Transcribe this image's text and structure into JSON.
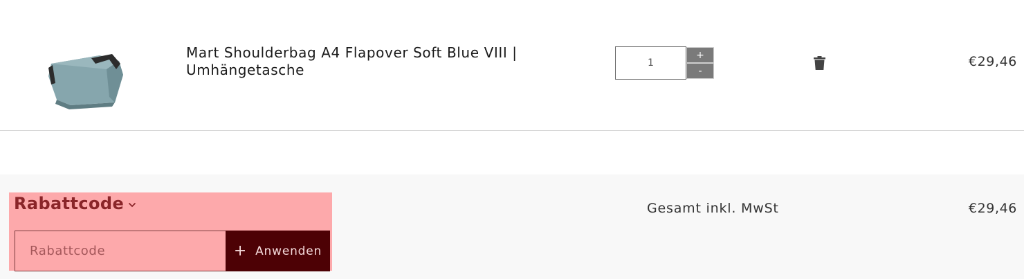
{
  "cart": {
    "items": [
      {
        "image_icon": "shoulder-bag-image",
        "name": "Mart Shoulderbag A4 Flapover Soft Blue VIII | Umhängetasche",
        "quantity": "1",
        "plus_label": "+",
        "minus_label": "-",
        "delete_icon": "trash-icon",
        "price": "€29,46"
      }
    ]
  },
  "discount": {
    "title": "Rabattcode",
    "chevron_icon": "chevron-down-icon",
    "input_value": "",
    "input_placeholder": "Rabattcode",
    "apply_icon": "plus-icon",
    "apply_label": "Anwenden"
  },
  "summary": {
    "total_label": "Gesamt inkl. MwSt",
    "total_value": "€29,46"
  },
  "colors": {
    "discount_panel_bg": "#fda9ab",
    "discount_title": "#8a2529",
    "apply_button_bg": "#4d0105",
    "qty_button_bg": "#7a7a7a",
    "summary_bg": "#f8f8f8"
  }
}
